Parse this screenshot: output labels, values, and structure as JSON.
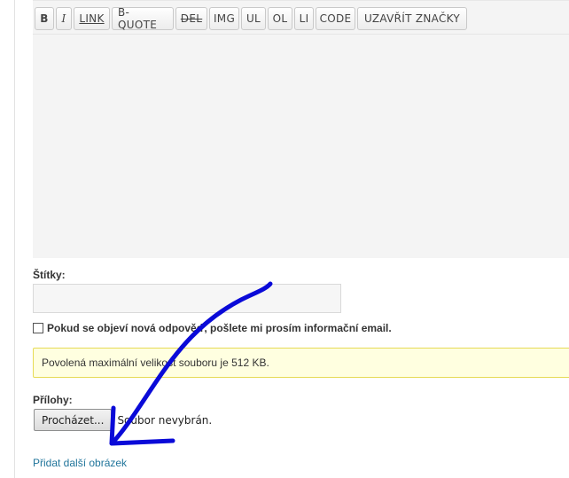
{
  "toolbar": {
    "buttons": [
      {
        "label": "B"
      },
      {
        "label": "I"
      },
      {
        "label": "LINK"
      },
      {
        "label": "B-QUOTE"
      },
      {
        "label": "DEL"
      },
      {
        "label": "IMG"
      },
      {
        "label": "UL"
      },
      {
        "label": "OL"
      },
      {
        "label": "LI"
      },
      {
        "label": "CODE"
      },
      {
        "label": "UZAVŘÍT ZNAČKY"
      }
    ]
  },
  "editor": {
    "content": ""
  },
  "tags": {
    "label": "Štítky:",
    "value": ""
  },
  "notify": {
    "checked": false,
    "label": "Pokud se objeví nová odpověď, pošlete mi prosím informační email."
  },
  "notice": {
    "text": "Povolená maximální velikost souboru je 512 KB."
  },
  "attachments": {
    "label": "Přílohy:",
    "browse_label": "Procházet...",
    "status": "Soubor nevybrán."
  },
  "add_image": {
    "label": "Přidat další obrázek"
  },
  "colors": {
    "annotation_stroke": "#0a0ad8",
    "notice_bg": "#ffffe0",
    "notice_border": "#e6db55",
    "link": "#21759b"
  }
}
